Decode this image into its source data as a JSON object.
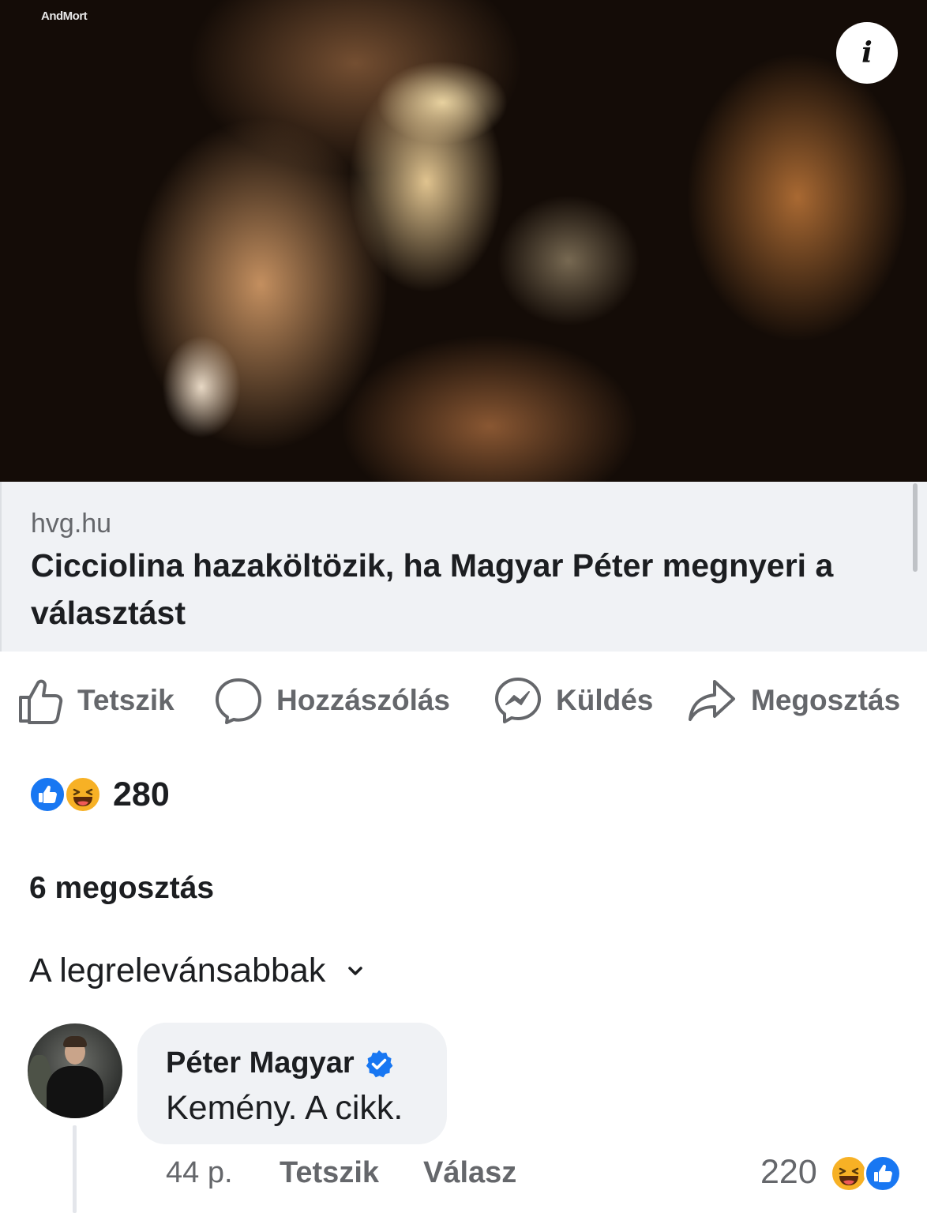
{
  "media": {
    "watermark": "AndMort",
    "info_icon": "info-icon"
  },
  "link_preview": {
    "domain": "hvg.hu",
    "title": "Cicciolina hazaköltözik, ha Magyar Péter megnyeri a választást"
  },
  "actions": {
    "like": {
      "label": "Tetszik",
      "icon": "thumbs-up-icon"
    },
    "comment": {
      "label": "Hozzászólás",
      "icon": "comment-bubble-icon"
    },
    "send": {
      "label": "Küldés",
      "icon": "messenger-icon"
    },
    "share": {
      "label": "Megosztás",
      "icon": "share-arrow-icon"
    }
  },
  "stats": {
    "reactions": [
      "like",
      "haha"
    ],
    "reaction_count": "280",
    "shares": "6 megosztás"
  },
  "sort": {
    "label": "A legrelevánsabbak",
    "icon": "chevron-down-icon"
  },
  "comment": {
    "author": "Péter Magyar",
    "verified": true,
    "text": "Kemény. A cikk.",
    "time": "44 p.",
    "like_label": "Tetszik",
    "reply_label": "Válasz",
    "reaction_count": "220",
    "reactions": [
      "haha",
      "like"
    ]
  },
  "colors": {
    "brand_blue": "#1877f2",
    "haha_yellow": "#f7b125",
    "secondary_text": "#65676b",
    "bubble_bg": "#f0f2f5"
  }
}
